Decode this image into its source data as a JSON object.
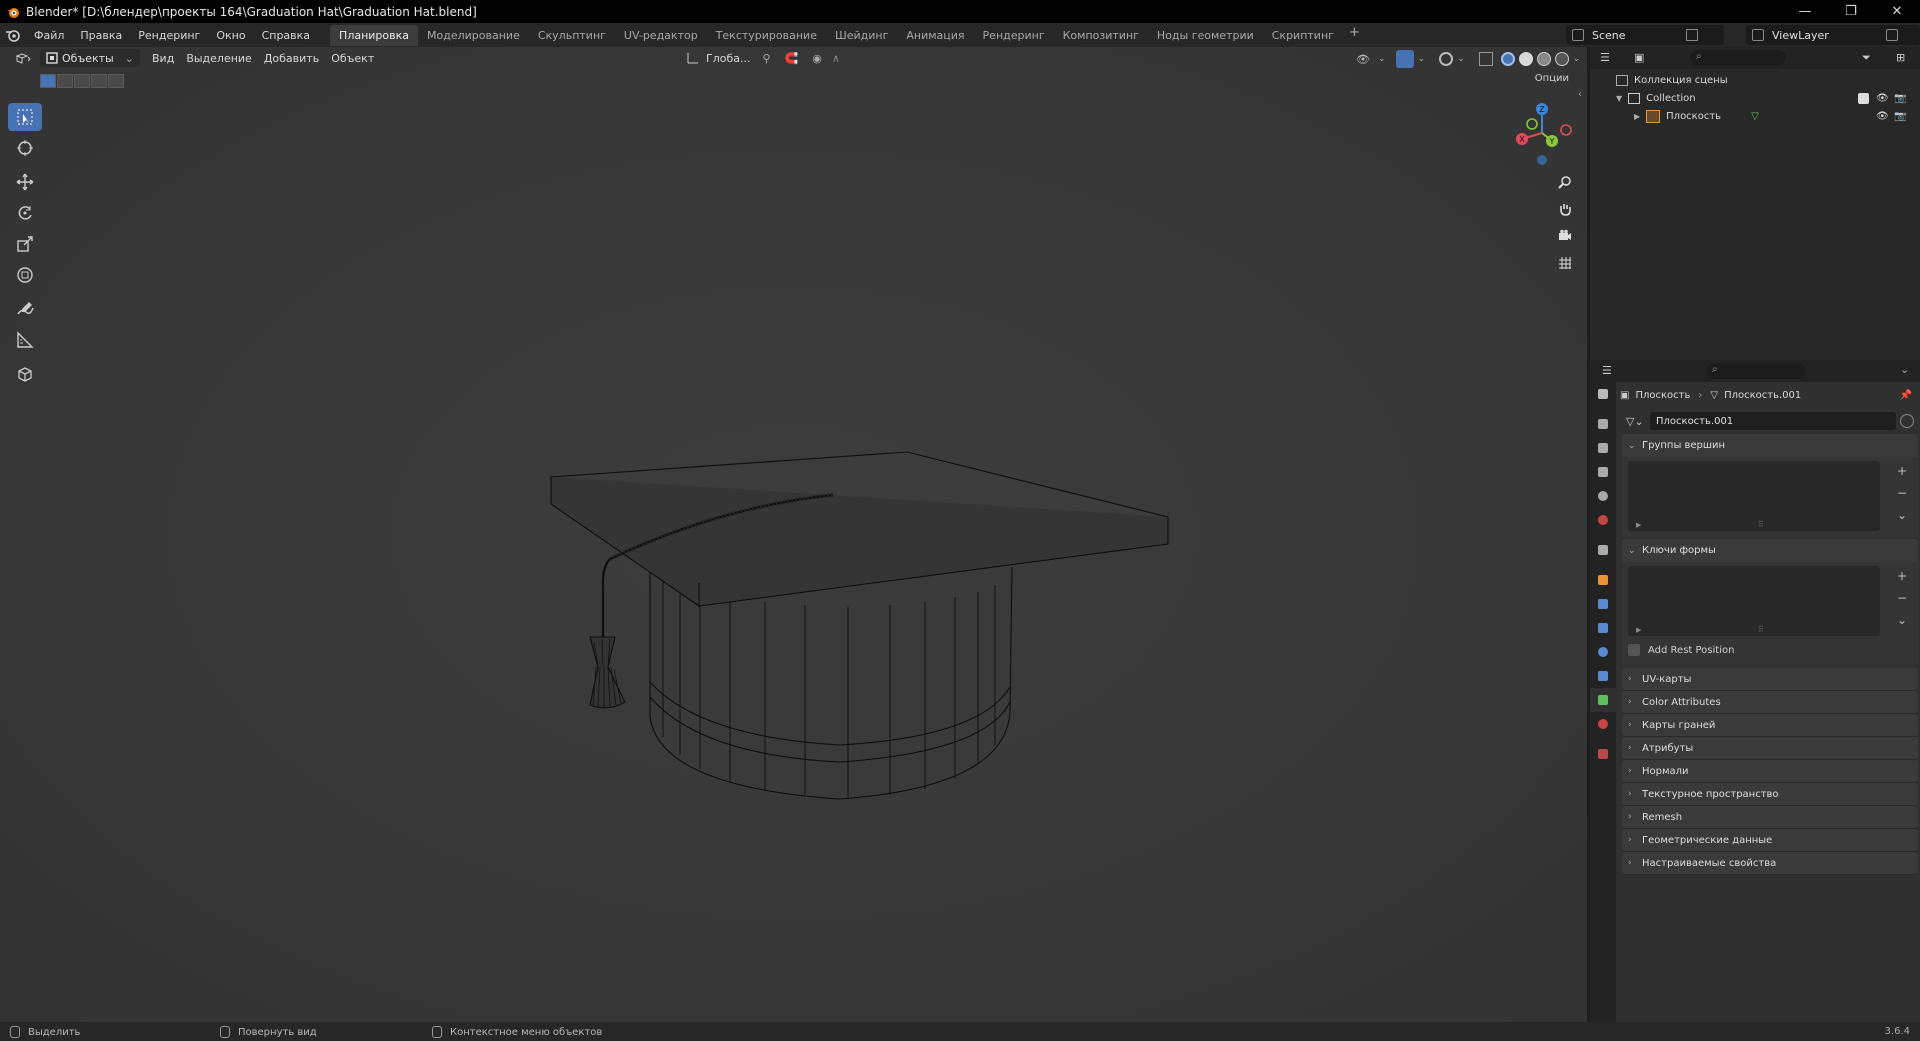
{
  "window": {
    "title": "Blender* [D:\\блендер\\проекты 164\\Graduation Hat\\Graduation Hat.blend]",
    "controls": [
      "—",
      "❐",
      "✕"
    ]
  },
  "menu": [
    "Файл",
    "Правка",
    "Рендеринг",
    "Окно",
    "Справка"
  ],
  "workspaces": [
    "Планировка",
    "Моделирование",
    "Скульптинг",
    "UV-редактор",
    "Текстурирование",
    "Шейдинг",
    "Анимация",
    "Рендеринг",
    "Композитинг",
    "Ноды геометрии",
    "Скриптинг"
  ],
  "active_workspace": "Планировка",
  "add_workspace": "+",
  "scene": "Scene",
  "view_layer": "ViewLayer",
  "viewport": {
    "mode": "Объекты",
    "menus": [
      "Вид",
      "Выделение",
      "Добавить",
      "Объект"
    ],
    "transform": "Глоба...",
    "options": "Опции"
  },
  "tools": [
    "select-box",
    "cursor",
    "move",
    "rotate",
    "scale",
    "transform",
    "annotate",
    "measure",
    "add-cube"
  ],
  "gizmo": {
    "x": "X",
    "y": "Y",
    "z": "Z"
  },
  "outliner": {
    "root": "Коллекция сцены",
    "collection": "Collection",
    "object": "Плоскость"
  },
  "properties": {
    "breadcrumb_object": "Плоскость",
    "breadcrumb_mesh": "Плоскость.001",
    "mesh_name": "Плоскость.001",
    "vertex_groups": "Группы вершин",
    "shape_keys": "Ключи формы",
    "add_rest_position": "Add Rest Position",
    "collapsed_panels": [
      "UV-карты",
      "Color Attributes",
      "Карты граней",
      "Атрибуты",
      "Нормали",
      "Текстурное пространство",
      "Remesh",
      "Геометрические данные",
      "Настраиваемые свойства"
    ]
  },
  "status": {
    "select": "Выделить",
    "rotate_view": "Повернуть вид",
    "context_menu": "Контекстное меню объектов",
    "version": "3.6.4"
  },
  "colors": {
    "accent": "#4772b3",
    "x_axis": "#e24a5b",
    "y_axis": "#8cc43a",
    "z_axis": "#3a86d4",
    "object_orange": "#e8923a",
    "mesh_green": "#5fbf5f"
  }
}
